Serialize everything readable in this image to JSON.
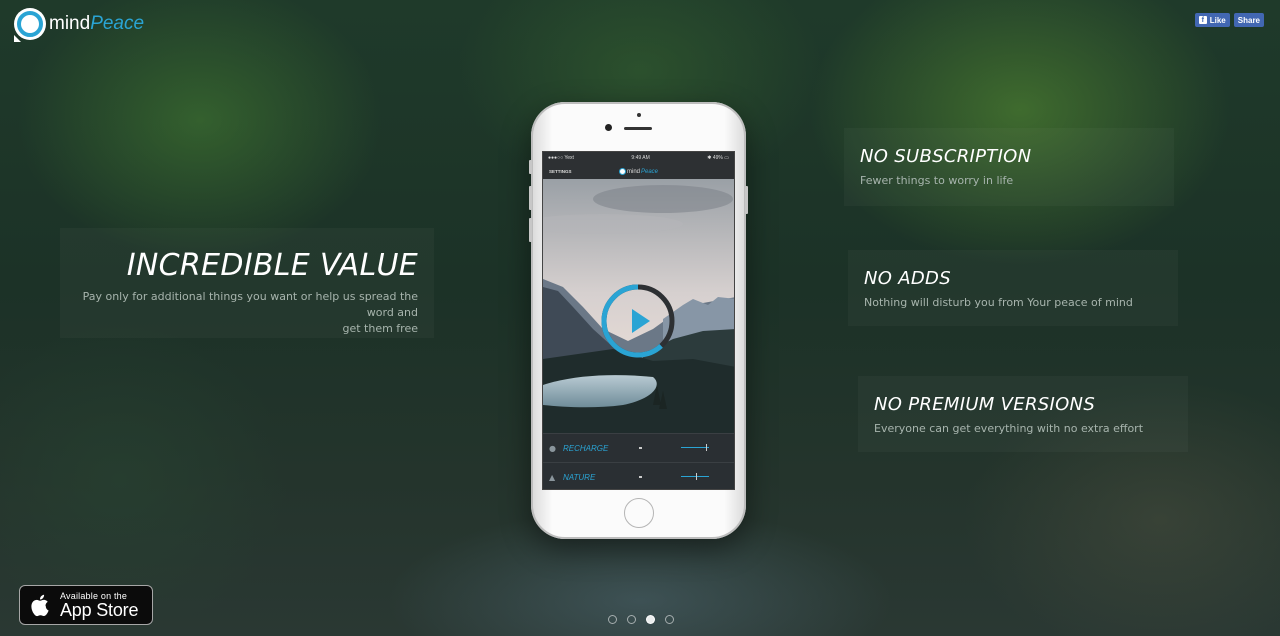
{
  "brand": {
    "word1": "mind",
    "word2": "Peace"
  },
  "social": {
    "like_label": "Like",
    "share_label": "Share"
  },
  "features": {
    "left": {
      "title": "INCREDIBLE VALUE",
      "desc_line1": "Pay only for additional things you want or help us spread the word and",
      "desc_line2": "get them free"
    },
    "right": [
      {
        "title": "NO SUBSCRIPTION",
        "desc": "Fewer things to worry in life"
      },
      {
        "title": "NO ADDS",
        "desc": "Nothing will disturb you from Your peace of mind"
      },
      {
        "title": "NO PREMIUM VERSIONS",
        "desc": "Everyone can get everything with no extra effort"
      }
    ]
  },
  "phone": {
    "status": {
      "carrier": "●●●○○ Yext",
      "time": "9:49 AM",
      "battery": "49%"
    },
    "nav": {
      "settings_label": "SETTINGS",
      "logo_word1": "mind",
      "logo_word2": "Peace"
    },
    "player": {
      "progress": 0.62
    },
    "tracks": [
      {
        "label": "RECHARGE",
        "icon": "person-icon",
        "level": 0.9
      },
      {
        "label": "NATURE",
        "icon": "mountain-icon",
        "level": 0.55
      }
    ]
  },
  "appstore": {
    "line1": "Available on the",
    "line2": "App Store"
  },
  "pager": {
    "count": 4,
    "active_index": 2
  },
  "colors": {
    "accent": "#2aa4d4",
    "facebook": "#4267b2"
  }
}
